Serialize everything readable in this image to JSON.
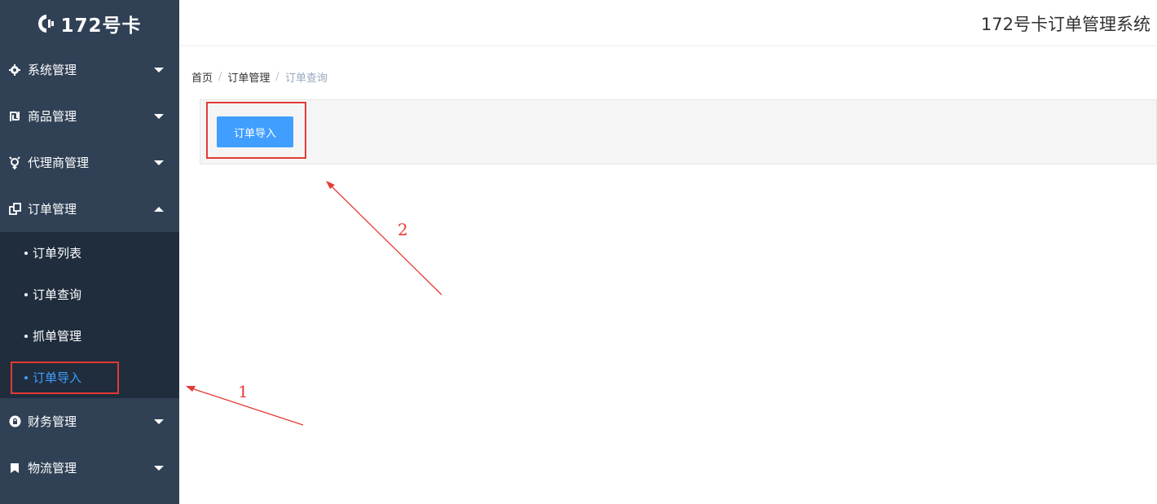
{
  "sidebar": {
    "logo_text": "172号卡",
    "items": [
      {
        "label": "系统管理",
        "icon": "gear-icon"
      },
      {
        "label": "商品管理",
        "icon": "shekel-icon"
      },
      {
        "label": "代理商管理",
        "icon": "gender-icon"
      },
      {
        "label": "订单管理",
        "icon": "copy-icon"
      },
      {
        "label": "财务管理",
        "icon": "lock-icon"
      },
      {
        "label": "物流管理",
        "icon": "bookmark-icon"
      }
    ],
    "sub_items": [
      {
        "label": "订单列表"
      },
      {
        "label": "订单查询"
      },
      {
        "label": "抓单管理"
      },
      {
        "label": "订单导入"
      }
    ]
  },
  "header": {
    "title": "172号卡订单管理系统"
  },
  "breadcrumb": [
    "首页",
    "订单管理",
    "订单查询"
  ],
  "toolbar": {
    "import_label": "订单导入"
  },
  "annotations": {
    "one": "1",
    "two": "2"
  },
  "colors": {
    "sidebar_bg": "#304156",
    "submenu_bg": "#1f2d3d",
    "accent": "#409eff",
    "annotation": "#e53935"
  }
}
